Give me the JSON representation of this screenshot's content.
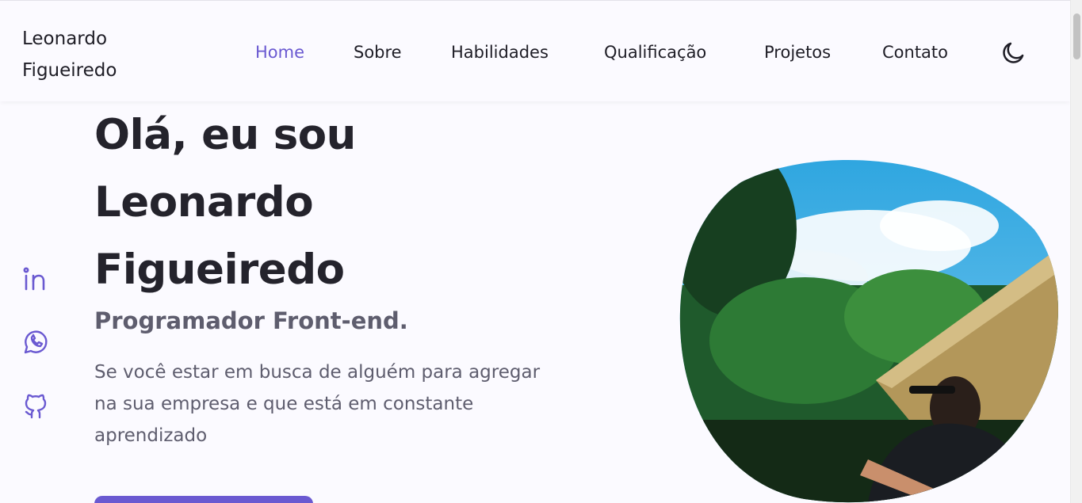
{
  "header": {
    "logo": "Leonardo Figueiredo",
    "nav": [
      {
        "label": "Home",
        "active": true
      },
      {
        "label": "Sobre",
        "active": false
      },
      {
        "label": "Habilidades",
        "active": false
      },
      {
        "label": "Qualificação",
        "active": false
      },
      {
        "label": "Projetos",
        "active": false
      },
      {
        "label": "Contato",
        "active": false
      }
    ],
    "theme_toggle_icon": "moon-icon"
  },
  "social": [
    {
      "icon": "linkedin-icon"
    },
    {
      "icon": "whatsapp-icon"
    },
    {
      "icon": "github-icon"
    }
  ],
  "hero": {
    "title_lines": [
      "Olá, eu sou",
      "Leonardo",
      "Figueiredo"
    ],
    "subtitle": "Programador Front-end.",
    "description": "Se você estar em busca de alguém para agregar na sua empresa e que está em constante aprendizado",
    "cta_label": ""
  },
  "colors": {
    "accent": "#6a59d1",
    "background": "#fbfaff",
    "text_dark": "#24232c",
    "text_muted": "#5e5d6e"
  }
}
